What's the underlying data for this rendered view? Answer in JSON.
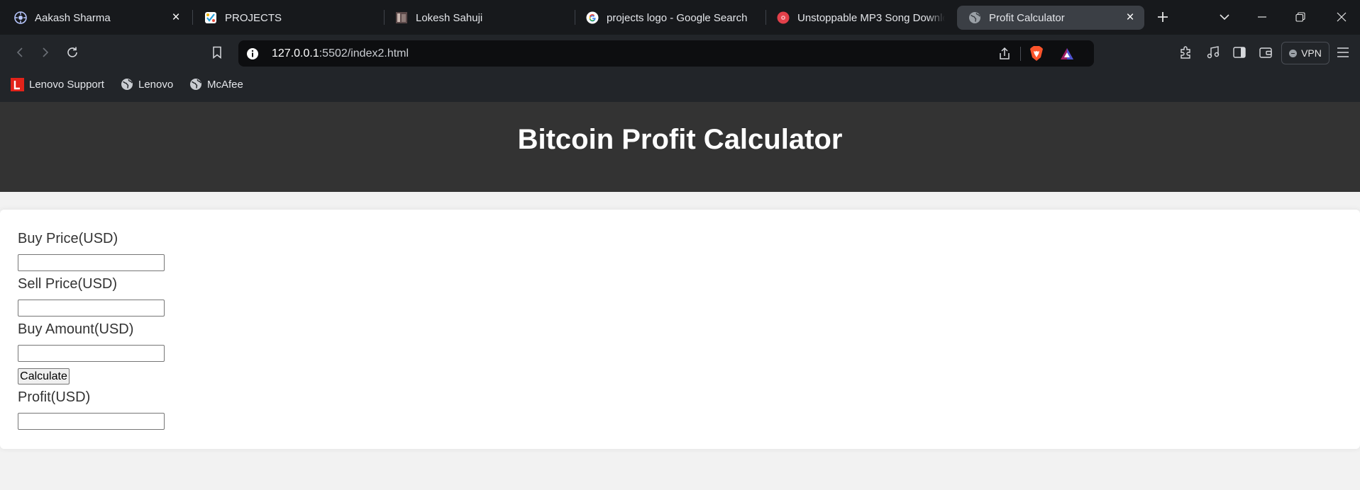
{
  "tabs": [
    {
      "title": "Aakash Sharma",
      "icon": "github-icon",
      "active": false,
      "has_close": true
    },
    {
      "title": "PROJECTS",
      "icon": "project-app-icon",
      "active": false
    },
    {
      "title": "Lokesh Sahuji",
      "icon": "profile-photo-icon",
      "active": false
    },
    {
      "title": "projects logo - Google Search",
      "icon": "google-icon",
      "active": false
    },
    {
      "title": "Unstoppable MP3 Song Downlo",
      "icon": "music-disc-icon",
      "active": false
    },
    {
      "title": "Profit Calculator",
      "icon": "globe-icon",
      "active": true,
      "has_close": true
    }
  ],
  "address_bar": {
    "host": "127.0.0.1",
    "rest": ":5502/index2.html"
  },
  "toolbar": {
    "vpn_label": "VPN"
  },
  "bookmarks": [
    {
      "label": "Lenovo Support",
      "icon": "lenovo-icon"
    },
    {
      "label": "Lenovo",
      "icon": "globe-icon"
    },
    {
      "label": "McAfee",
      "icon": "globe-icon"
    }
  ],
  "page": {
    "title": "Bitcoin Profit Calculator",
    "fields": {
      "buy_price_label": "Buy Price(USD)",
      "buy_price_value": "",
      "sell_price_label": "Sell Price(USD)",
      "sell_price_value": "",
      "buy_amount_label": "Buy Amount(USD)",
      "buy_amount_value": "",
      "profit_label": "Profit(USD)",
      "profit_value": ""
    },
    "calculate_label": "Calculate"
  },
  "colors": {
    "tab_strip_bg": "#17191c",
    "toolbar_bg": "#222529",
    "page_header_bg": "#333333",
    "page_bg": "#f2f2f2",
    "card_bg": "#ffffff"
  }
}
